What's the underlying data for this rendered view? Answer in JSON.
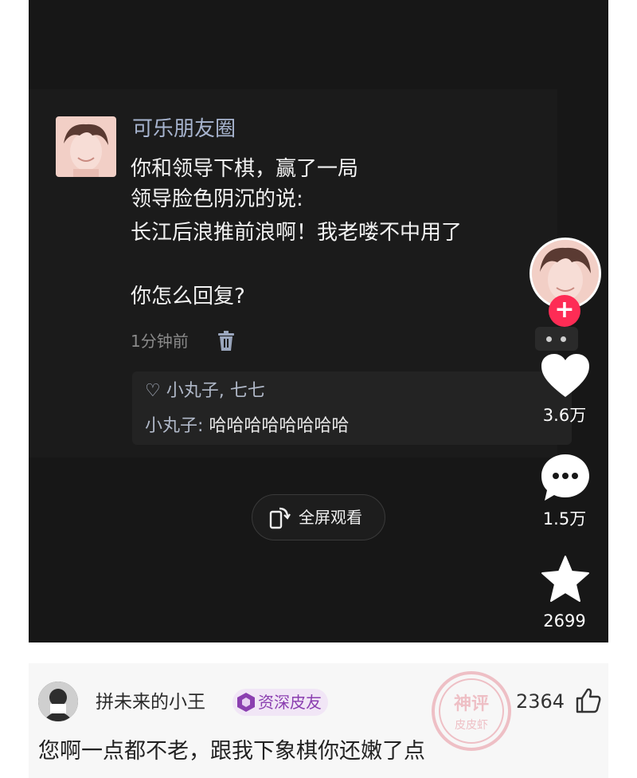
{
  "post": {
    "author": "可乐朋友圈",
    "lines": [
      "你和领导下棋，赢了一局",
      "领导脸色阴沉的说:",
      "长江后浪推前浪啊！我老喽不中用了",
      "你怎么回复?"
    ],
    "time": "1分钟前",
    "likers": "♡ 小丸子, 七七",
    "reply_name": "小丸子:",
    "reply_text": " 哈哈哈哈哈哈哈哈"
  },
  "player": {
    "fullscreen_label": "全屏观看",
    "follow_symbol": "+",
    "likes": "3.6万",
    "comments": "1.5万",
    "favorites": "2699",
    "accent": "#fe2c55"
  },
  "comment": {
    "username": "拼未来的小王",
    "badge": "资深皮友",
    "like_count": "2364",
    "text": "您啊一点都不老，跟我下象棋你还嫩了点",
    "badge_color": "#8b3fb0",
    "watermark_text": [
      "神评",
      "皮皮虾"
    ]
  }
}
